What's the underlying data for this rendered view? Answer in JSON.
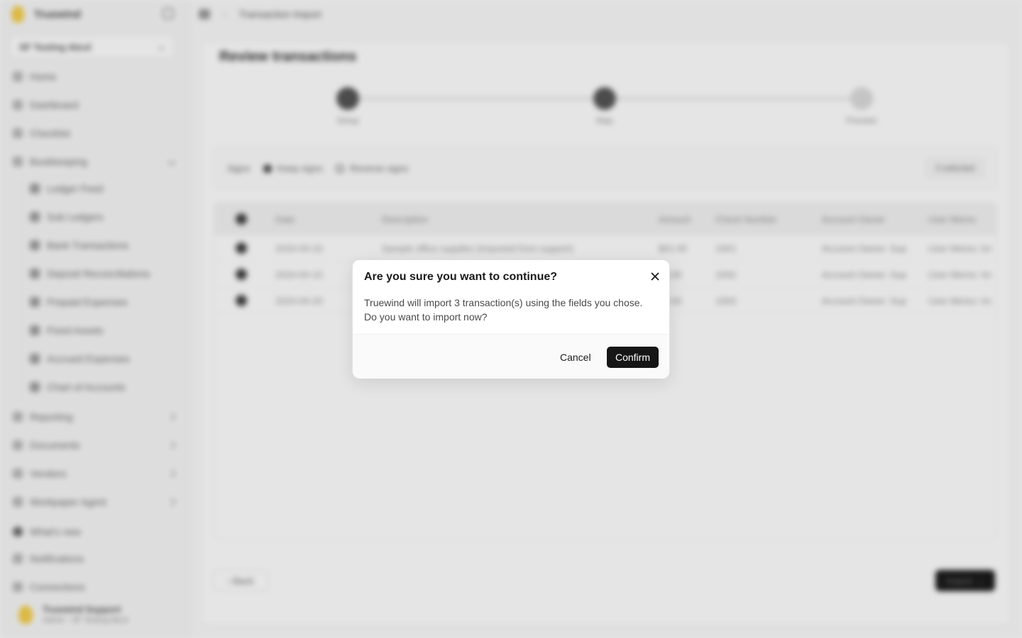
{
  "sidebar": {
    "brand": "Truewind",
    "org": "SF Testing Abcd",
    "items": [
      {
        "label": "Home"
      },
      {
        "label": "Dashboard"
      },
      {
        "label": "Checklist"
      },
      {
        "label": "Bookkeeping"
      },
      {
        "label": "Ledger Feed"
      },
      {
        "label": "Sub Ledgers"
      },
      {
        "label": "Bank Transactions"
      },
      {
        "label": "Deposit Reconciliations"
      },
      {
        "label": "Prepaid Expenses"
      },
      {
        "label": "Fixed Assets"
      },
      {
        "label": "Accrued Expenses"
      },
      {
        "label": "Chart of Accounts"
      },
      {
        "label": "Reporting"
      },
      {
        "label": "Documents"
      },
      {
        "label": "Vendors"
      },
      {
        "label": "Workpaper Agent"
      },
      {
        "label": "What's new"
      },
      {
        "label": "Notifications"
      },
      {
        "label": "Connections"
      }
    ],
    "user": {
      "name": "Truewind Support",
      "sub": "Admin · SF Testing Abcd"
    }
  },
  "breadcrumb": {
    "current": "Transaction Import"
  },
  "page": {
    "title": "Review transactions",
    "steps": [
      {
        "label": "Setup",
        "state": "done"
      },
      {
        "label": "Map",
        "state": "done"
      },
      {
        "label": "Preview",
        "state": "todo"
      }
    ],
    "signs": {
      "label": "Signs",
      "keep": "Keep signs",
      "reverse": "Reverse signs",
      "selected": "3 selected"
    },
    "table": {
      "columns": [
        "Date",
        "Description",
        "Amount",
        "Check Number",
        "Account Owner",
        "User Memo"
      ],
      "rows": [
        [
          "2024-04-10",
          "Sample office supplies (Imported from support)",
          "$61.00",
          "1001",
          "Account Owner: Sup",
          "User Memo: Im"
        ],
        [
          "2024-04-15",
          "",
          "$0.00",
          "1002",
          "Account Owner: Sup",
          "User Memo: Im"
        ],
        [
          "2024-04-20",
          "",
          "$0.00",
          "1003",
          "Account Owner: Sup",
          "User Memo: Im"
        ]
      ]
    },
    "back_label": "Back",
    "import_label": "Import"
  },
  "modal": {
    "title": "Are you sure you want to continue?",
    "body_line1": "Truewind will import 3 transaction(s) using the fields you chose.",
    "body_line2": "Do you want to import now?",
    "cancel_label": "Cancel",
    "confirm_label": "Confirm",
    "close_icon": "close-icon"
  }
}
